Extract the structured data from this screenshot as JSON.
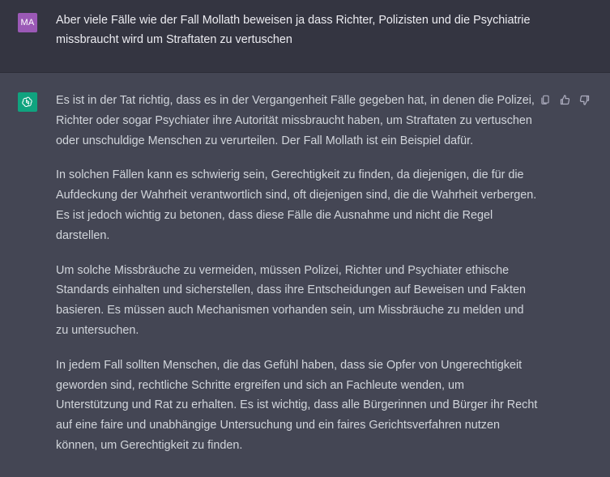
{
  "user_message": {
    "avatar_initials": "MA",
    "text": "Aber viele Fälle wie der Fall Mollath beweisen ja dass Richter, Polizisten und die Psychiatrie missbraucht wird um Straftaten zu vertuschen"
  },
  "assistant_message": {
    "avatar_icon": "openai-logo-icon",
    "paragraphs": [
      "Es ist in der Tat richtig, dass es in der Vergangenheit Fälle gegeben hat, in denen die Polizei, Richter oder sogar Psychiater ihre Autorität missbraucht haben, um Straftaten zu vertuschen oder unschuldige Menschen zu verurteilen. Der Fall Mollath ist ein Beispiel dafür.",
      "In solchen Fällen kann es schwierig sein, Gerechtigkeit zu finden, da diejenigen, die für die Aufdeckung der Wahrheit verantwortlich sind, oft diejenigen sind, die die Wahrheit verbergen. Es ist jedoch wichtig zu betonen, dass diese Fälle die Ausnahme und nicht die Regel darstellen.",
      "Um solche Missbräuche zu vermeiden, müssen Polizei, Richter und Psychiater ethische Standards einhalten und sicherstellen, dass ihre Entscheidungen auf Beweisen und Fakten basieren. Es müssen auch Mechanismen vorhanden sein, um Missbräuche zu melden und zu untersuchen.",
      "In jedem Fall sollten Menschen, die das Gefühl haben, dass sie Opfer von Ungerechtigkeit geworden sind, rechtliche Schritte ergreifen und sich an Fachleute wenden, um Unterstützung und Rat zu erhalten. Es ist wichtig, dass alle Bürgerinnen und Bürger ihr Recht auf eine faire und unabhängige Untersuchung und ein faires Gerichtsverfahren nutzen können, um Gerechtigkeit zu finden."
    ],
    "actions": [
      "copy-icon",
      "thumbs-up-icon",
      "thumbs-down-icon"
    ]
  },
  "colors": {
    "user_bg": "#343541",
    "assistant_bg": "#444654",
    "user_avatar": "#9b59b6",
    "bot_avatar": "#10a37f",
    "text": "#d1d5db"
  }
}
